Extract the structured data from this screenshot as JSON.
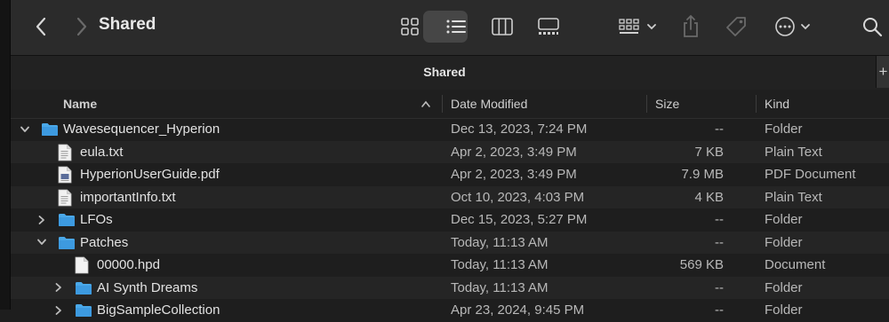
{
  "window": {
    "title": "Shared",
    "tab_title": "Shared",
    "tab_add": "+"
  },
  "columns": {
    "name": "Name",
    "date": "Date Modified",
    "size": "Size",
    "kind": "Kind"
  },
  "rows": [
    {
      "name": "Wavesequencer_Hyperion",
      "date": "Dec 13, 2023, 7:24 PM",
      "size": "--",
      "kind": "Folder",
      "type": "folder",
      "expanded": true,
      "depth": 0
    },
    {
      "name": "eula.txt",
      "date": "Apr 2, 2023, 3:49 PM",
      "size": "7 KB",
      "kind": "Plain Text",
      "type": "text-file",
      "depth": 1
    },
    {
      "name": "HyperionUserGuide.pdf",
      "date": "Apr 2, 2023, 3:49 PM",
      "size": "7.9 MB",
      "kind": "PDF Document",
      "type": "pdf-file",
      "depth": 1
    },
    {
      "name": "importantInfo.txt",
      "date": "Oct 10, 2023, 4:03 PM",
      "size": "4 KB",
      "kind": "Plain Text",
      "type": "text-file",
      "depth": 1
    },
    {
      "name": "LFOs",
      "date": "Dec 15, 2023, 5:27 PM",
      "size": "--",
      "kind": "Folder",
      "type": "folder",
      "expanded": false,
      "depth": 1
    },
    {
      "name": "Patches",
      "date": "Today, 11:13 AM",
      "size": "--",
      "kind": "Folder",
      "type": "folder",
      "expanded": true,
      "depth": 1
    },
    {
      "name": "00000.hpd",
      "date": "Today, 11:13 AM",
      "size": "569 KB",
      "kind": "Document",
      "type": "document-file",
      "depth": 2
    },
    {
      "name": "AI Synth Dreams",
      "date": "Today, 11:13 AM",
      "size": "--",
      "kind": "Folder",
      "type": "folder",
      "expanded": false,
      "depth": 2
    },
    {
      "name": "BigSampleCollection",
      "date": "Apr 23, 2024, 9:45 PM",
      "size": "--",
      "kind": "Folder",
      "type": "folder",
      "expanded": false,
      "depth": 2
    }
  ],
  "colors": {
    "folder": "#4aa8e8",
    "toolbar": "#2b2b2b",
    "background": "#1e1e1e"
  },
  "icons": [
    "back-icon",
    "forward-icon",
    "icon-view-icon",
    "list-view-icon",
    "column-view-icon",
    "gallery-view-icon",
    "group-icon",
    "share-icon",
    "tag-icon",
    "more-actions-icon",
    "search-icon"
  ]
}
